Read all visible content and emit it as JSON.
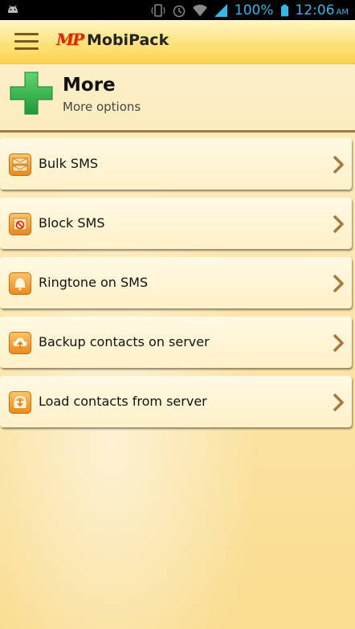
{
  "status_bar": {
    "battery": "100%",
    "time": "12:06",
    "time_suffix": "AM"
  },
  "action_bar": {
    "logo_text": "MP",
    "title": "MobiPack"
  },
  "header": {
    "title": "More",
    "subtitle": "More options"
  },
  "menu_items": [
    {
      "label": "Bulk SMS",
      "icon": "envelopes-icon"
    },
    {
      "label": "Block SMS",
      "icon": "block-sms-icon"
    },
    {
      "label": "Ringtone on SMS",
      "icon": "bell-icon"
    },
    {
      "label": "Backup contacts on server",
      "icon": "cloud-upload-icon"
    },
    {
      "label": "Load contacts from server",
      "icon": "cloud-download-icon"
    }
  ],
  "colors": {
    "accent_orange": "#ea8a1c",
    "chevron_brown": "#a8773a",
    "plus_green": "#2fb34a"
  }
}
